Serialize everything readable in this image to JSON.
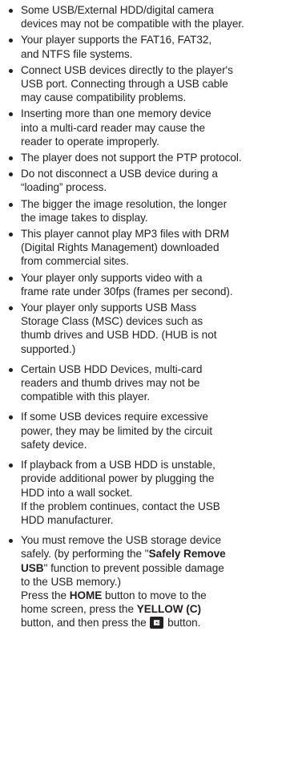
{
  "notes": [
    {
      "lines": [
        "Some USB/External HDD/digital camera",
        "devices may not be compatible with the player."
      ]
    },
    {
      "lines": [
        "Your player supports the FAT16, FAT32,",
        "and NTFS file systems."
      ]
    },
    {
      "lines": [
        "Connect USB devices directly to the player's",
        "USB port. Connecting through a USB cable",
        "may cause compatibility problems."
      ]
    },
    {
      "lines": [
        "Inserting more than one memory device",
        "into a multi-card reader may cause the",
        "reader to operate improperly."
      ]
    },
    {
      "lines": [
        "The player does not support the PTP protocol."
      ]
    },
    {
      "lines": [
        "Do not disconnect a USB device during a",
        "“loading” process."
      ]
    },
    {
      "lines": [
        "The bigger the image resolution, the longer",
        "the image takes to display."
      ]
    },
    {
      "lines": [
        "This player cannot play MP3 files with DRM",
        "(Digital Rights Management) downloaded",
        "from commercial sites."
      ]
    },
    {
      "lines": [
        "Your player only supports video with a",
        "frame rate under 30fps (frames per second)."
      ]
    },
    {
      "lines": [
        "Your player only supports USB Mass",
        "Storage Class (MSC) devices such as",
        "thumb drives and USB HDD. (HUB is not",
        "supported.)"
      ]
    },
    {
      "lines": [
        "Certain USB HDD Devices, multi-card",
        "readers and thumb drives may not be",
        "compatible with this player."
      ]
    },
    {
      "lines": [
        "If some USB devices require excessive",
        "power, they may be limited by the circuit",
        "safety device."
      ]
    },
    {
      "lines": [
        "If playback from a USB HDD is unstable,",
        "provide additional power by plugging the",
        "HDD into a wall socket.",
        "If the problem continues, contact the USB",
        "HDD manufacturer."
      ]
    }
  ],
  "last_note": {
    "line1": "You must remove the USB storage device",
    "line2_pre": "safely. (by performing the \"",
    "line2_bold": "Safely Remove",
    "line3_bold": "USB",
    "line3_post": "\" function to prevent possible damage",
    "line4": "to the USB memory.)",
    "line5_pre": "Press the ",
    "line5_bold": "HOME",
    "line5_post": " button to move to the",
    "line6_pre": "home screen, press the ",
    "line6_bold": "YELLOW (C)",
    "line7_pre": "button, and then press the ",
    "line7_icon": "eject-icon",
    "line7_post": " button."
  }
}
